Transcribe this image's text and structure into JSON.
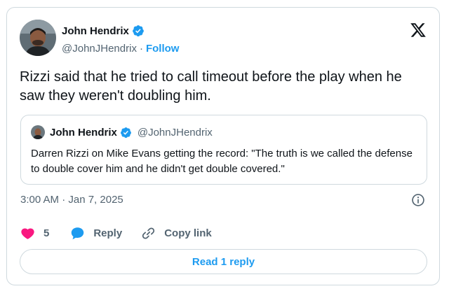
{
  "author": {
    "name": "John Hendrix",
    "handle": "@JohnJHendrix",
    "separator": "·",
    "follow_label": "Follow"
  },
  "tweet": {
    "text": "Rizzi said that he tried to call timeout before the play when he saw they weren't doubling him."
  },
  "quote": {
    "name": "John Hendrix",
    "handle": "@JohnJHendrix",
    "text": "Darren Rizzi on Mike Evans getting the record: \"The truth is we called the defense to double cover him and he didn't get double covered.\""
  },
  "timestamp": "3:00 AM · Jan 7, 2025",
  "actions": {
    "like_count": "5",
    "reply_label": "Reply",
    "copy_label": "Copy link"
  },
  "read_reply_label": "Read 1 reply",
  "colors": {
    "accent": "#1d9bf0",
    "like": "#f91880",
    "muted": "#536471",
    "border": "#cfd9de"
  },
  "icons": [
    "verified-badge-icon",
    "x-logo-icon",
    "info-icon",
    "heart-icon",
    "reply-bubble-icon",
    "link-icon"
  ]
}
